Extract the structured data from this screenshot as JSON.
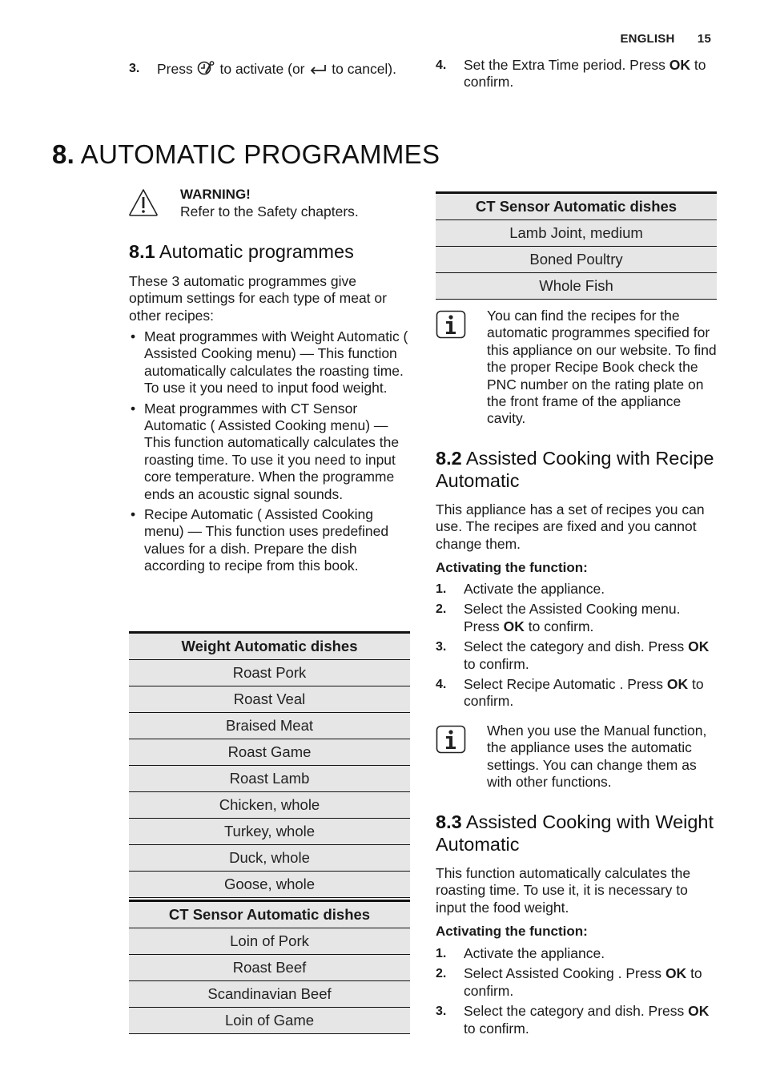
{
  "header": {
    "language": "ENGLISH",
    "page_number": "15"
  },
  "top_steps": {
    "left": {
      "num": "3.",
      "pre": "Press",
      "mid": "to activate (or",
      "post": "to cancel).",
      "icon1": "clock-key-icon",
      "icon2": "return-arrow-icon"
    },
    "right": {
      "num": "4.",
      "line1": "Set the Extra Time period. Press",
      "ok": "OK",
      "line2": "to confirm."
    }
  },
  "chapter": {
    "number": "8.",
    "title": "AUTOMATIC PROGRAMMES"
  },
  "warning": {
    "icon": "warning-triangle-icon",
    "title": "WARNING!",
    "text": "Refer to the Safety chapters."
  },
  "section_8_1": {
    "number": "8.1",
    "title": "Automatic programmes",
    "intro": "These 3 automatic programmes give optimum settings for each type of meat or other recipes:",
    "bullets": [
      "Meat programmes with Weight Automatic ( Assisted Cooking menu) — This function automatically calculates the roasting time. To use it you need to input food weight.",
      "Meat programmes with CT Sensor Automatic ( Assisted Cooking menu) — This function automatically calculates the roasting time. To use it you need to input core temperature. When the programme ends an acoustic signal sounds.",
      "Recipe Automatic ( Assisted Cooking menu) — This function uses predefined values for a dish. Prepare the dish according to recipe from this book."
    ]
  },
  "weight_table": {
    "header": "Weight Automatic dishes",
    "rows": [
      "Roast Pork",
      "Roast Veal",
      "Braised Meat",
      "Roast Game",
      "Roast Lamb",
      "Chicken, whole",
      "Turkey, whole",
      "Duck, whole",
      "Goose, whole"
    ]
  },
  "ct_table_left": {
    "header": "CT Sensor Automatic dishes",
    "rows": [
      "Loin of Pork",
      "Roast Beef",
      "Scandinavian Beef",
      "Loin of Game"
    ]
  },
  "ct_table_right": {
    "header": "CT Sensor Automatic dishes",
    "rows": [
      "Lamb Joint, medium",
      "Boned Poultry",
      "Whole Fish"
    ]
  },
  "info_1": {
    "icon": "info-icon",
    "text": "You can find the recipes for the automatic programmes specified for this appliance on our website. To find the proper Recipe Book check the PNC number on the rating plate on the front frame of the appliance cavity."
  },
  "section_8_2": {
    "number": "8.2",
    "title": "Assisted Cooking with Recipe Automatic",
    "intro": "This appliance has a set of recipes you can use. The recipes are fixed and you cannot change them.",
    "subheading": "Activating the function:",
    "steps": [
      {
        "num": "1.",
        "text": "Activate the appliance.",
        "ok": "",
        "after": ""
      },
      {
        "num": "2.",
        "text": "Select the Assisted Cooking menu. Press",
        "ok": "OK",
        "after": "to confirm."
      },
      {
        "num": "3.",
        "text": "Select the category and dish. Press",
        "ok": "OK",
        "after": "to confirm."
      },
      {
        "num": "4.",
        "text": "Select Recipe Automatic . Press",
        "ok": "OK",
        "after": "to confirm."
      }
    ]
  },
  "info_2": {
    "icon": "info-icon",
    "text": "When you use the Manual function, the appliance uses the automatic settings. You can change them as with other functions."
  },
  "section_8_3": {
    "number": "8.3",
    "title": "Assisted Cooking with Weight Automatic",
    "intro": "This function automatically calculates the roasting time. To use it, it is necessary to input the food weight.",
    "subheading": "Activating the function:",
    "steps": [
      {
        "num": "1.",
        "text": "Activate the appliance.",
        "ok": "",
        "after": ""
      },
      {
        "num": "2.",
        "text": "Select Assisted Cooking . Press",
        "ok": "OK",
        "after": "to confirm."
      },
      {
        "num": "3.",
        "text": "Select the category and dish. Press",
        "ok": "OK",
        "after": "to confirm."
      }
    ]
  }
}
